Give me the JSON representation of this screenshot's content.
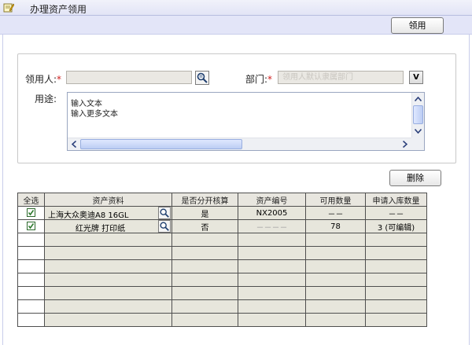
{
  "header": {
    "title": "办理资产领用",
    "icon": "edit-note-icon"
  },
  "toolbar": {
    "take_label": "领用"
  },
  "form": {
    "recipient_label": "领用人:",
    "recipient_required": "*",
    "recipient_value": "",
    "department_label": "部门:",
    "department_required": "*",
    "department_placeholder": "领用人默认隶属部门",
    "department_button": "V",
    "purpose_label": "用途:",
    "purpose_lines": [
      "输入文本",
      "输入更多文本"
    ]
  },
  "actions": {
    "delete_label": "删除"
  },
  "table": {
    "columns": [
      "全选",
      "资产资料",
      "是否分开核算",
      "资产编号",
      "可用数量",
      "申请入库数量"
    ],
    "rows": [
      {
        "checked": true,
        "name": "上海大众奥迪A8 16GL",
        "separate": "是",
        "code": "NX2005",
        "available": "－－",
        "requested": "－－"
      },
      {
        "checked": true,
        "name": "红光牌 打印纸",
        "separate": "否",
        "code": "－－－－",
        "available": "78",
        "requested": "3 (可编辑)"
      }
    ],
    "empty_rows": 7
  },
  "colors": {
    "required": "#d02020",
    "toolbar": "#e3e5f8",
    "grid_cell": "#e7e6dc",
    "check": "#2d6a2d"
  }
}
